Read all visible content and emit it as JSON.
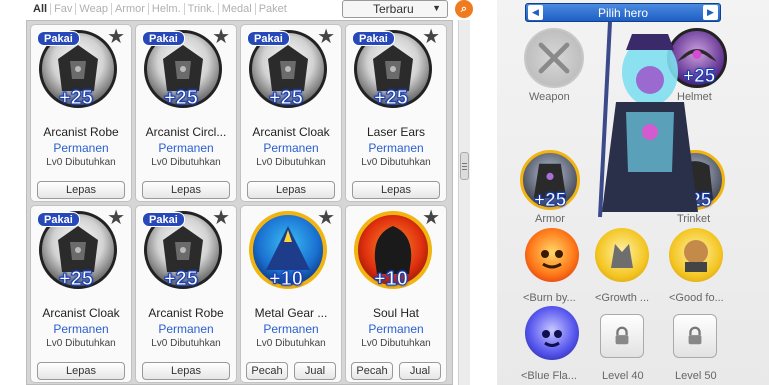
{
  "filter_tabs": [
    "All",
    "Fav",
    "Weap",
    "Armor",
    "Helm.",
    "Trink.",
    "Medal",
    "Paket"
  ],
  "sort": {
    "selected": "Terbaru"
  },
  "inventory": [
    {
      "name": "Arcanist Robe",
      "pakai": "Pakai",
      "plus": "+25",
      "status": "Permanen",
      "req": "Lv0 Dibutuhkan",
      "buttons": [
        "Lepas"
      ],
      "style": "dark"
    },
    {
      "name": "Arcanist Circl...",
      "pakai": "Pakai",
      "plus": "+25",
      "status": "Permanen",
      "req": "Lv0 Dibutuhkan",
      "buttons": [
        "Lepas"
      ],
      "style": "dark"
    },
    {
      "name": "Arcanist Cloak",
      "pakai": "Pakai",
      "plus": "+25",
      "status": "Permanen",
      "req": "Lv0 Dibutuhkan",
      "buttons": [
        "Lepas"
      ],
      "style": "dark"
    },
    {
      "name": "Laser Ears",
      "pakai": "Pakai",
      "plus": "+25",
      "status": "Permanen",
      "req": "Lv0 Dibutuhkan",
      "buttons": [
        "Lepas"
      ],
      "style": "dark"
    },
    {
      "name": "Arcanist Cloak",
      "pakai": "Pakai",
      "plus": "+25",
      "status": "Permanen",
      "req": "Lv0 Dibutuhkan",
      "buttons": [
        "Lepas"
      ],
      "style": "dark"
    },
    {
      "name": "Arcanist Robe",
      "pakai": "Pakai",
      "plus": "+25",
      "status": "Permanen",
      "req": "Lv0 Dibutuhkan",
      "buttons": [
        "Lepas"
      ],
      "style": "dark"
    },
    {
      "name": "Metal Gear ...",
      "pakai": "",
      "plus": "+10",
      "status": "Permanen",
      "req": "Lv0 Dibutuhkan",
      "buttons": [
        "Pecah",
        "Jual"
      ],
      "style": "gold"
    },
    {
      "name": "Soul Hat",
      "pakai": "",
      "plus": "+10",
      "status": "Permanen",
      "req": "Lv0 Dibutuhkan",
      "buttons": [
        "Pecah",
        "Jual"
      ],
      "style": "fire"
    }
  ],
  "hero_panel": {
    "title": "Pilih hero",
    "weapon_label": "Weapon",
    "helmet_label": "Helmet",
    "armor_label": "Armor",
    "trinket_label": "Trinket",
    "helmet_plus": "+25",
    "armor_plus": "+25",
    "trinket_plus": "+25",
    "medals": [
      "<Burn by...",
      "<Growth ...",
      "<Good fo...",
      "<Blue Fla..."
    ],
    "locked": [
      "Level 40",
      "Level 50"
    ]
  },
  "colors": {
    "accent_blue": "#1f5fc4",
    "search_orange": "#f07a1e",
    "gold_ring": "#f2b411"
  }
}
